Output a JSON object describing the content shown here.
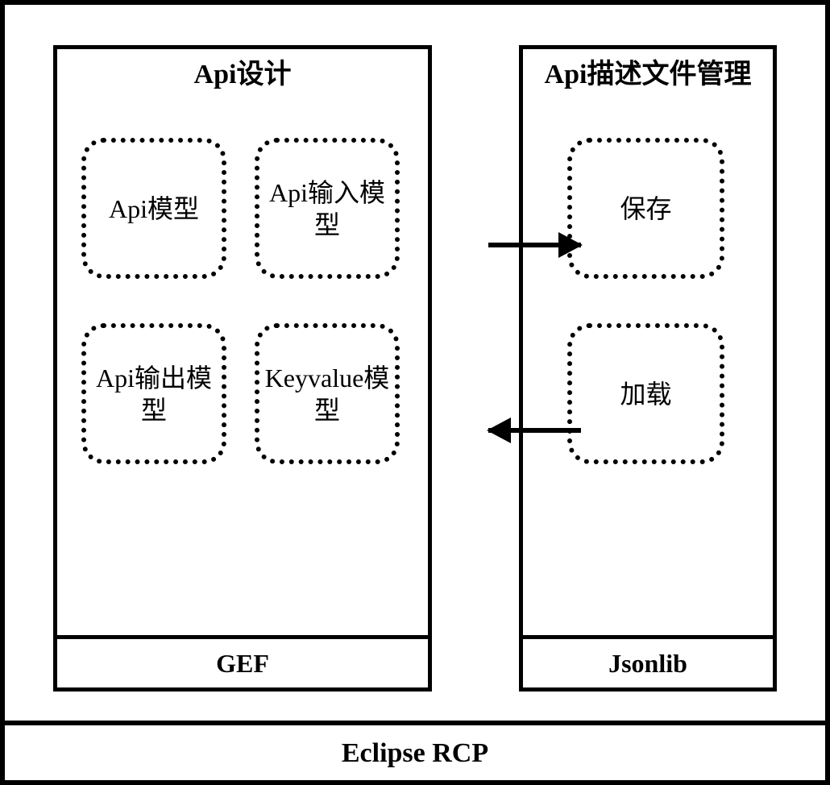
{
  "left": {
    "title": "Api设计",
    "footer": "GEF",
    "boxes": {
      "api_model": "Api模型",
      "api_input": "Api输入模型",
      "api_output": "Api输出模型",
      "keyvalue": "Keyvalue模型"
    }
  },
  "right": {
    "title": "Api描述文件管理",
    "footer": "Jsonlib",
    "boxes": {
      "save": "保存",
      "load": "加载"
    }
  },
  "bottom": "Eclipse RCP"
}
